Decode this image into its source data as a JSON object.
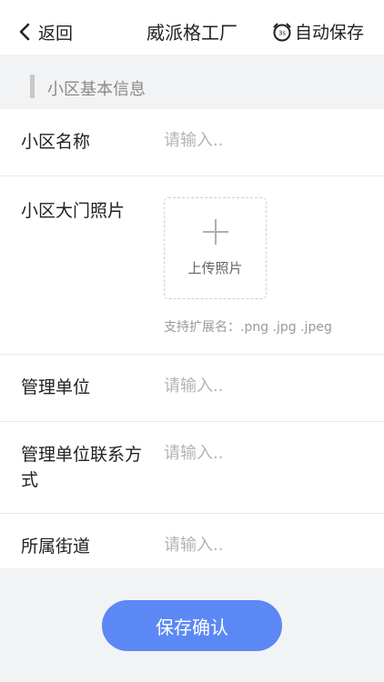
{
  "nav": {
    "back_label": "返回",
    "title": "威派格工厂",
    "autosave_label": "自动保存",
    "autosave_icon_text": "3s"
  },
  "section": {
    "title": "小区基本信息"
  },
  "form": {
    "name": {
      "label": "小区名称",
      "placeholder": "请输入.."
    },
    "gate_photo": {
      "label": "小区大门照片",
      "upload_label": "上传照片",
      "hint": "支持扩展名：.png .jpg .jpeg"
    },
    "management_unit": {
      "label": "管理单位",
      "placeholder": "请输入.."
    },
    "management_contact": {
      "label": "管理单位联系方式",
      "placeholder": "请输入.."
    },
    "street": {
      "label": "所属街道",
      "placeholder": "请输入.."
    }
  },
  "submit_label": "保存确认",
  "colors": {
    "accent": "#5b88f5",
    "background": "#f2f3f5",
    "placeholder": "#b4b4b4"
  },
  "icons": [
    "chevron-left-icon",
    "alarm-clock-icon",
    "plus-icon"
  ]
}
